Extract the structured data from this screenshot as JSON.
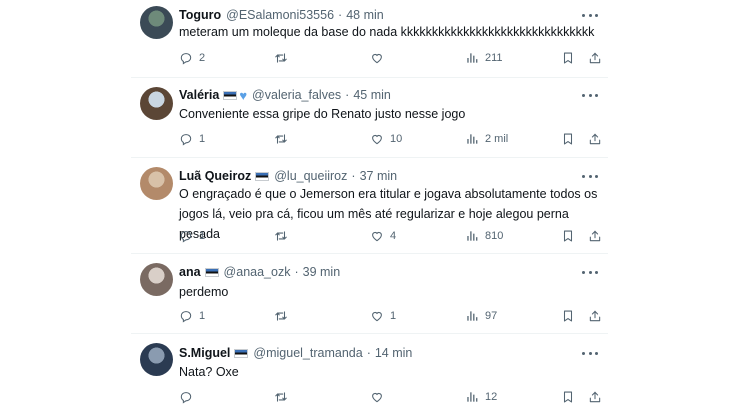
{
  "tweets": [
    {
      "name": "Toguro",
      "badges": [],
      "handle": "@ESalamoni53556",
      "time": "48 min",
      "text": [
        "meteram um moleque da base do nada kkkkkkkkkkkkkkkkkkkkkkkkkkkkkkk"
      ],
      "replies": "2",
      "retweets": "",
      "likes": "",
      "views": "211",
      "avatar_colors": [
        "#3b4a56",
        "#6e8a7a"
      ]
    },
    {
      "name": "Valéria",
      "badges": [
        "flag",
        "blue-heart"
      ],
      "handle": "@valeria_falves",
      "time": "45 min",
      "text": [
        "Conveniente essa gripe do Renato justo nesse jogo"
      ],
      "replies": "1",
      "retweets": "",
      "likes": "10",
      "views": "2 mil",
      "avatar_colors": [
        "#5b4636",
        "#c9d6e2"
      ]
    },
    {
      "name": "Luã Queiroz",
      "badges": [
        "flag"
      ],
      "handle": "@lu_queiiroz",
      "time": "37 min",
      "text": [
        "O engraçado é que o Jemerson era titular e jogava absolutamente todos os",
        "jogos lá, veio pra cá, ficou um mês até regularizar e hoje alegou perna pesada"
      ],
      "replies": "1",
      "retweets": "",
      "likes": "4",
      "views": "810",
      "avatar_colors": [
        "#b38a6a",
        "#d8c1a8"
      ]
    },
    {
      "name": "ana",
      "badges": [
        "flag"
      ],
      "handle": "@anaa_ozk",
      "time": "39 min",
      "text": [
        "perdemo"
      ],
      "replies": "1",
      "retweets": "",
      "likes": "1",
      "views": "97",
      "avatar_colors": [
        "#7a6a62",
        "#d9cfc8"
      ]
    },
    {
      "name": "S.Miguel",
      "badges": [
        "flag"
      ],
      "handle": "@miguel_tramanda",
      "time": "14 min",
      "text": [
        "Nata? Oxe"
      ],
      "replies": "",
      "retweets": "",
      "likes": "",
      "views": "12",
      "avatar_colors": [
        "#2b3b52",
        "#8a9bb0"
      ]
    }
  ],
  "separator": "·",
  "colors": {
    "text": "#0f1419",
    "muted": "#536471",
    "divider": "#eff3f4",
    "flag_blue": "#3a6fb5",
    "flag_black": "#111111",
    "flag_white": "#ffffff",
    "heart": "#5aa0e6"
  },
  "icons": [
    "reply-icon",
    "retweet-icon",
    "like-icon",
    "views-icon",
    "bookmark-icon",
    "share-icon",
    "more-icon"
  ]
}
